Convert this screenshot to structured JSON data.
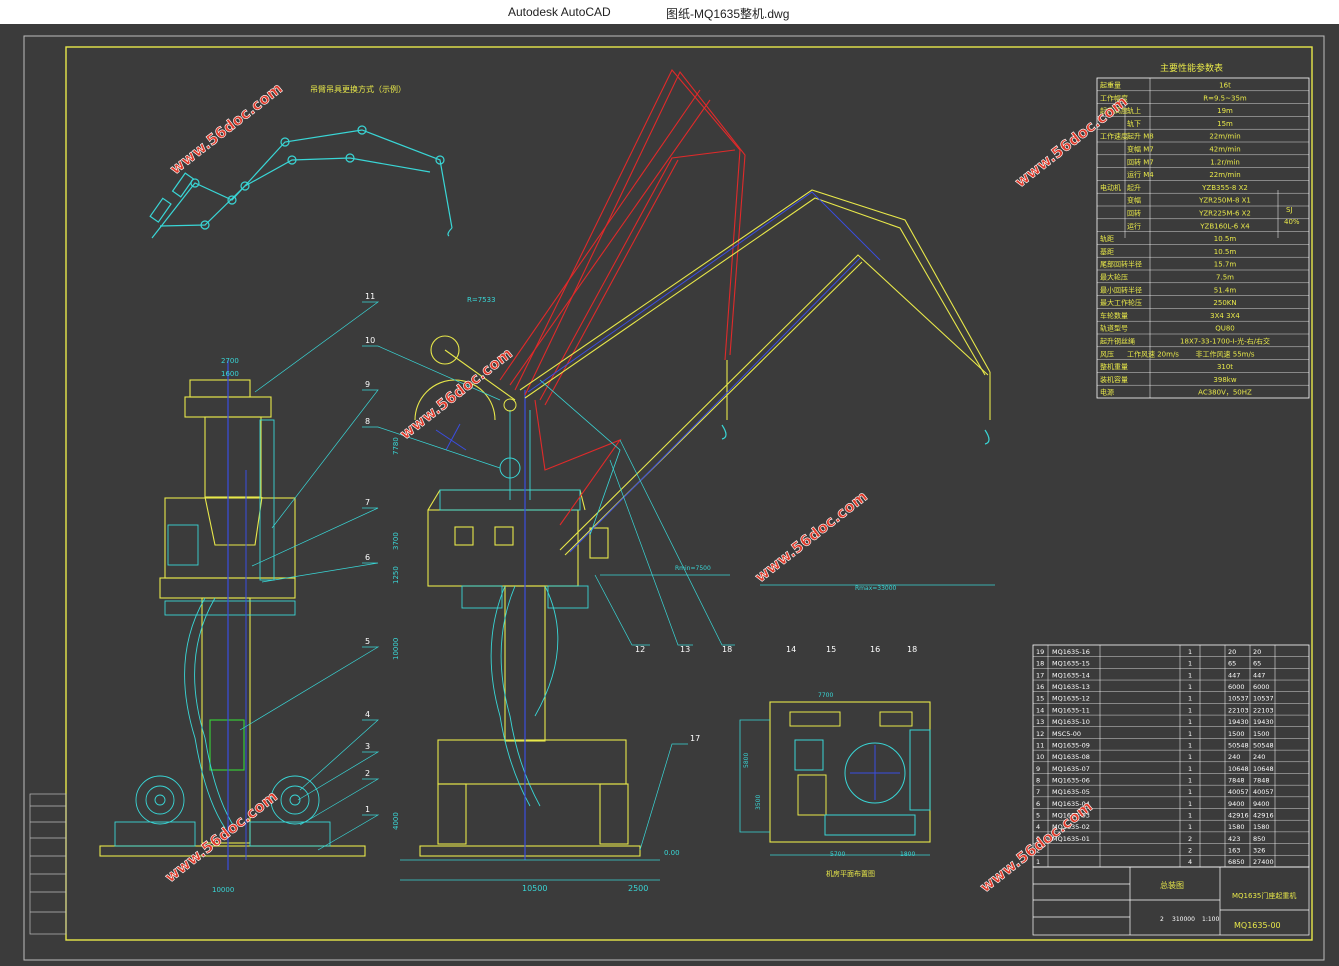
{
  "window": {
    "app_name": "Autodesk AutoCAD",
    "document_title": "图纸-MQ1635整机.dwg"
  },
  "colors": {
    "background": "#3b3b3b",
    "frame": "#e8e84a",
    "cyan": "#39d6d6",
    "yellow": "#e8e84a",
    "red": "#e02a2a",
    "blue": "#3a4de0",
    "watermark": "#e03a2a"
  },
  "drawing": {
    "top_left_label": "吊臂吊具更换方式（示例）",
    "balloons": [
      "11",
      "10",
      "9",
      "8",
      "7",
      "6",
      "5",
      "4",
      "3",
      "2",
      "1",
      "12",
      "13",
      "18",
      "14",
      "15",
      "16",
      "18",
      "17"
    ],
    "dims": {
      "left_top_2700": "2700",
      "left_top_1600": "1600",
      "left_bottom": "10000",
      "center_top": "R=7533",
      "center_7780": "7780",
      "center_3700": "3700",
      "center_1250": "1250",
      "center_10000": "10000",
      "center_4000": "4000",
      "center_10500": "10500",
      "center_2500": "2500",
      "rmin": "Rmin=7500",
      "rmax": "Rmax=33000",
      "level": "0.00",
      "plan_7700": "7700",
      "plan_5800": "5800",
      "plan_3500": "3500",
      "plan_5700": "5700",
      "plan_1800": "1800",
      "plan_caption": "机房平面布置图"
    }
  },
  "watermark": "www.56doc.com",
  "spec_table": {
    "title": "主要性能参数表",
    "rows": [
      {
        "label": "起重量",
        "sub": "",
        "value": "16t"
      },
      {
        "label": "工作幅度",
        "sub": "",
        "value": "R=9.5~35m"
      },
      {
        "label": "起升高度",
        "sub": "轨上",
        "value": "19m"
      },
      {
        "label": "",
        "sub": "轨下",
        "value": "15m"
      },
      {
        "label": "工作速度",
        "sub": "起升 M8",
        "value": "22m/min"
      },
      {
        "label": "",
        "sub": "变幅 M7",
        "value": "42m/min"
      },
      {
        "label": "",
        "sub": "回转 M7",
        "value": "1.2r/min"
      },
      {
        "label": "",
        "sub": "运行 M4",
        "value": "22m/min"
      },
      {
        "label": "电动机",
        "sub": "起升",
        "value": "YZB355-8 X2"
      },
      {
        "label": "",
        "sub": "变幅",
        "value": "YZR250M-8 X1"
      },
      {
        "label": "",
        "sub": "回转",
        "value": "YZR225M-6 X2"
      },
      {
        "label": "",
        "sub": "运行",
        "value": "YZB160L-6 X4"
      },
      {
        "label": "轨距",
        "sub": "",
        "value": "10.5m"
      },
      {
        "label": "基距",
        "sub": "",
        "value": "10.5m"
      },
      {
        "label": "尾部回转半径",
        "sub": "",
        "value": "15.7m"
      },
      {
        "label": "最大轮压",
        "sub": "",
        "value": "7.5m"
      },
      {
        "label": "最小回转半径",
        "sub": "",
        "value": "51.4m"
      },
      {
        "label": "最大工作轮压",
        "sub": "",
        "value": "250KN"
      },
      {
        "label": "车轮数量",
        "sub": "",
        "value": "3X4   3X4"
      },
      {
        "label": "轨道型号",
        "sub": "",
        "value": "QU80"
      },
      {
        "label": "起升钢丝绳",
        "sub": "",
        "value": "18X7-33-1700-I-光-右/右交"
      },
      {
        "label": "风压",
        "sub": "工作风速 20m/s",
        "value": "非工作风速 55m/s"
      },
      {
        "label": "整机重量",
        "sub": "",
        "value": "310t"
      },
      {
        "label": "装机容量",
        "sub": "",
        "value": "398kw"
      },
      {
        "label": "电源",
        "sub": "",
        "value": "AC380V，50HZ"
      }
    ],
    "sj": "SJ",
    "sj_pct": "40%"
  },
  "bom": {
    "rows": [
      [
        "19",
        "MQ1635-16",
        "",
        "1",
        "20",
        "20"
      ],
      [
        "18",
        "MQ1635-15",
        "",
        "1",
        "65",
        "65"
      ],
      [
        "17",
        "MQ1635-14",
        "",
        "1",
        "447",
        "447"
      ],
      [
        "16",
        "MQ1635-13",
        "",
        "1",
        "6000",
        "6000"
      ],
      [
        "15",
        "MQ1635-12",
        "",
        "1",
        "10537",
        "10537"
      ],
      [
        "14",
        "MQ1635-11",
        "",
        "1",
        "22103",
        "22103"
      ],
      [
        "13",
        "MQ1635-10",
        "",
        "1",
        "19430",
        "19430"
      ],
      [
        "12",
        "MSC5-00",
        "",
        "1",
        "1500",
        "1500"
      ],
      [
        "11",
        "MQ1635-09",
        "",
        "1",
        "50548",
        "50548"
      ],
      [
        "10",
        "MQ1635-08",
        "",
        "1",
        "240",
        "240"
      ],
      [
        "9",
        "MQ1635-07",
        "",
        "1",
        "10648",
        "10648"
      ],
      [
        "8",
        "MQ1635-06",
        "",
        "1",
        "7848",
        "7848"
      ],
      [
        "7",
        "MQ1635-05",
        "",
        "1",
        "40057",
        "40057"
      ],
      [
        "6",
        "MQ1635-04",
        "",
        "1",
        "9400",
        "9400"
      ],
      [
        "5",
        "MQ1635-03",
        "",
        "1",
        "42916",
        "42916"
      ],
      [
        "4",
        "MQ1635-02",
        "",
        "1",
        "1580",
        "1580"
      ],
      [
        "3",
        "MQ1635-01",
        "",
        "2",
        "423",
        "850"
      ],
      [
        "2",
        "",
        "",
        "2",
        "163",
        "326"
      ],
      [
        "1",
        "",
        "",
        "4",
        "6850",
        "27400"
      ]
    ],
    "title_block_drawing_no": "MQ1635-00",
    "title_block_name": "MQ1635门座起重机",
    "title_block_assembly": "总装图",
    "scale": "1:100",
    "weight": "310000",
    "count": "2"
  }
}
